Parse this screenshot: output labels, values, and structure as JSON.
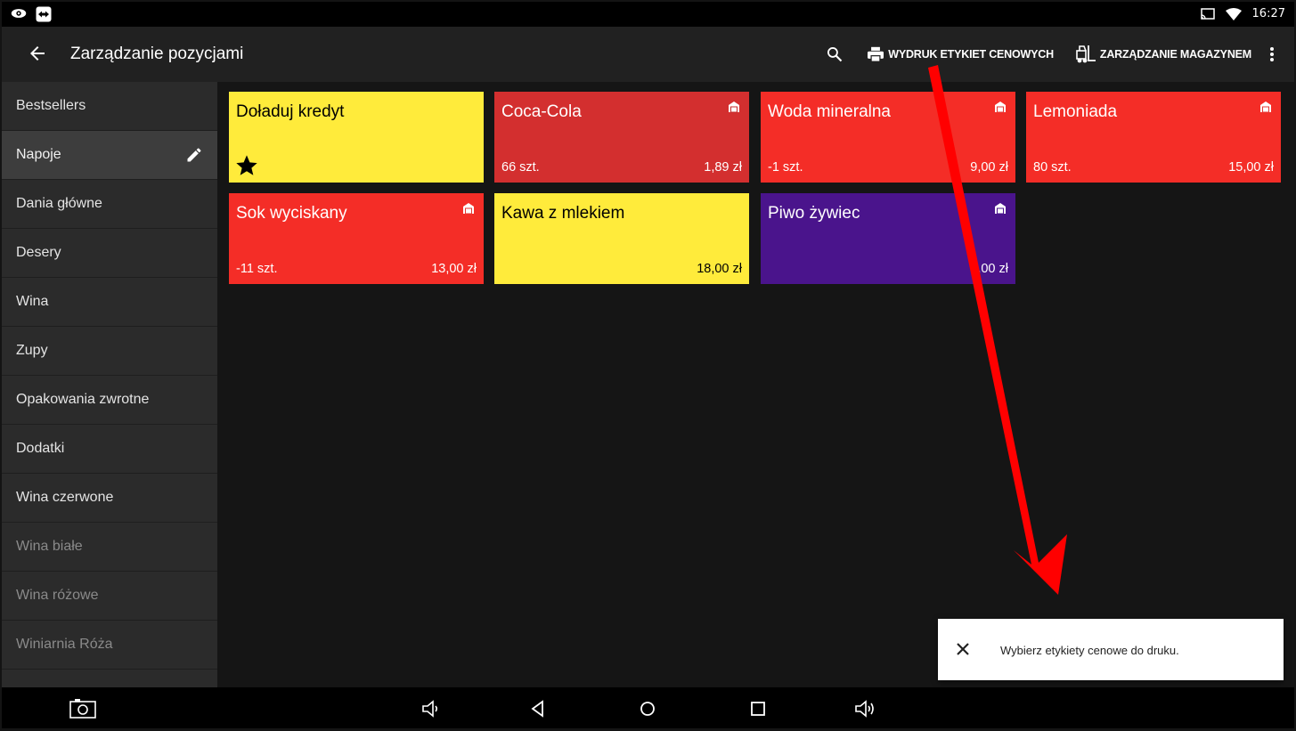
{
  "status_bar": {
    "time": "16:27"
  },
  "app_bar": {
    "title": "Zarządzanie pozycjami",
    "print_labels": "WYDRUK ETYKIET CENOWYCH",
    "warehouse": "ZARZĄDZANIE MAGAZYNEM"
  },
  "sidebar": {
    "items": [
      {
        "label": "Bestsellers"
      },
      {
        "label": "Napoje"
      },
      {
        "label": "Dania główne"
      },
      {
        "label": "Desery"
      },
      {
        "label": "Wina"
      },
      {
        "label": "Zupy"
      },
      {
        "label": "Opakowania zwrotne"
      },
      {
        "label": "Dodatki"
      },
      {
        "label": "Wina czerwone"
      },
      {
        "label": "Wina białe"
      },
      {
        "label": "Wina różowe"
      },
      {
        "label": "Winiarnia Róża"
      }
    ]
  },
  "products": [
    {
      "name": "Doładuj kredyt",
      "stock": "",
      "price": "",
      "color": "#ffeb3b"
    },
    {
      "name": "Coca-Cola",
      "stock": "66 szt.",
      "price": "1,89 zł",
      "color": "#d32f2f"
    },
    {
      "name": "Woda mineralna",
      "stock": "-1 szt.",
      "price": "9,00 zł",
      "color": "#f42d27"
    },
    {
      "name": "Lemoniada",
      "stock": "80 szt.",
      "price": "15,00 zł",
      "color": "#f42d27"
    },
    {
      "name": "Sok wyciskany",
      "stock": "-11 szt.",
      "price": "13,00 zł",
      "color": "#f42d27"
    },
    {
      "name": "Kawa z mlekiem",
      "stock": "",
      "price": "18,00 zł",
      "color": "#ffeb3b"
    },
    {
      "name": "Piwo żywiec",
      "stock": "",
      "price": "5,00 zł",
      "color": "#4a148c"
    }
  ],
  "snackbar": {
    "message": "Wybierz etykiety cenowe do druku."
  },
  "colors": {
    "arrow": "#ff0000",
    "appbar": "#212121",
    "sidebar": "#2b2b2b"
  }
}
